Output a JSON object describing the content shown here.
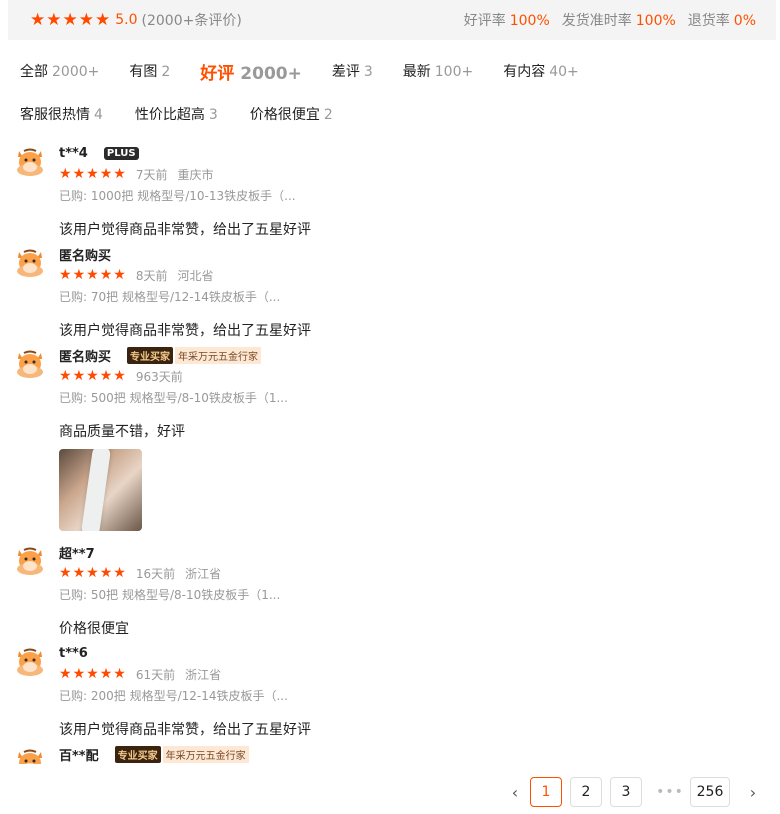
{
  "summary": {
    "score": "5.0",
    "count": "(2000+条评价)",
    "stats": [
      {
        "label": "好评率",
        "value": "100%"
      },
      {
        "label": "发货准时率",
        "value": "100%"
      },
      {
        "label": "退货率",
        "value": "0%"
      }
    ]
  },
  "tabs": [
    {
      "label": "全部",
      "count": "2000+"
    },
    {
      "label": "有图",
      "count": "2"
    },
    {
      "label": "好评",
      "count": "2000+",
      "active": true
    },
    {
      "label": "差评",
      "count": "3"
    },
    {
      "label": "最新",
      "count": "100+"
    },
    {
      "label": "有内容",
      "count": "40+"
    }
  ],
  "tags": [
    {
      "label": "客服很热情",
      "count": "4"
    },
    {
      "label": "性价比超高",
      "count": "3"
    },
    {
      "label": "价格很便宜",
      "count": "2"
    }
  ],
  "reviews": [
    {
      "user": "t**4",
      "badge": "PLUS",
      "time": "7天前",
      "location": "重庆市",
      "sku": "已购: 1000把 规格型号/10-13铁皮板手（...",
      "content": "该用户觉得商品非常赞，给出了五星好评"
    },
    {
      "user": "匿名购买",
      "time": "8天前",
      "location": "河北省",
      "sku": "已购: 70把 规格型号/12-14铁皮板手（...",
      "content": "该用户觉得商品非常赞，给出了五星好评"
    },
    {
      "user": "匿名购买",
      "badge_pro": "专业买家",
      "badge_tag": "年采万元五金行家",
      "time": "963天前",
      "location": "",
      "sku": "已购: 500把 规格型号/8-10铁皮板手（1...",
      "content": "商品质量不错，好评",
      "has_photo": true
    },
    {
      "user": "超**7",
      "time": "16天前",
      "location": "浙江省",
      "sku": "已购: 50把 规格型号/8-10铁皮板手（1...",
      "content": "价格很便宜"
    },
    {
      "user": "t**6",
      "time": "61天前",
      "location": "浙江省",
      "sku": "已购: 200把 规格型号/12-14铁皮板手（...",
      "content": "该用户觉得商品非常赞，给出了五星好评"
    },
    {
      "user": "百**配",
      "badge_pro": "专业买家",
      "badge_tag": "年采万元五金行家"
    }
  ],
  "pager": {
    "prev": "‹",
    "next": "›",
    "ellipsis": "•••",
    "pages": [
      "1",
      "2",
      "3"
    ],
    "last": "256",
    "current": "1"
  },
  "colors": {
    "accent": "#ff5000",
    "star": "#ff4a00"
  },
  "icons": {
    "star": "★",
    "avatar": "cartoon-cow-avatar-icon"
  }
}
